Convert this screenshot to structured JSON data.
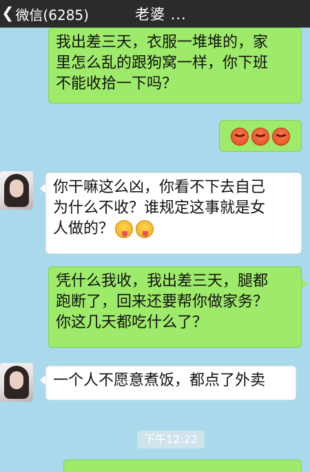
{
  "header": {
    "back_label": "微信(6285)",
    "title": "老婆 ..."
  },
  "messages": [
    {
      "sender": "me",
      "text": "我出差三天，衣服一堆堆的，家\n里怎么乱的跟狗窝一样，你下班\n不能收拾一下吗？"
    },
    {
      "sender": "me",
      "emojis": [
        "angry-face-icon",
        "angry-face-icon",
        "angry-face-icon"
      ]
    },
    {
      "sender": "them",
      "text": "你干嘛这么凶，你看不下去自己\n为什么不收？谁规定这事就是女\n人做的？",
      "emojis": [
        "tongue-face-icon",
        "tongue-face-icon"
      ]
    },
    {
      "sender": "me",
      "text": "凭什么我收，我出差三天，腿都\n跑断了，回来还要帮你做家务？\n你这几天都吃什么了？"
    },
    {
      "sender": "them",
      "text": "一个人不愿意煮饭，都点了外卖"
    }
  ],
  "timestamp": "下午12:22",
  "colors": {
    "background": "#a9d9ea",
    "my_bubble": "#9eea6a",
    "their_bubble": "#ffffff",
    "topbar": "#2b2b2b"
  }
}
